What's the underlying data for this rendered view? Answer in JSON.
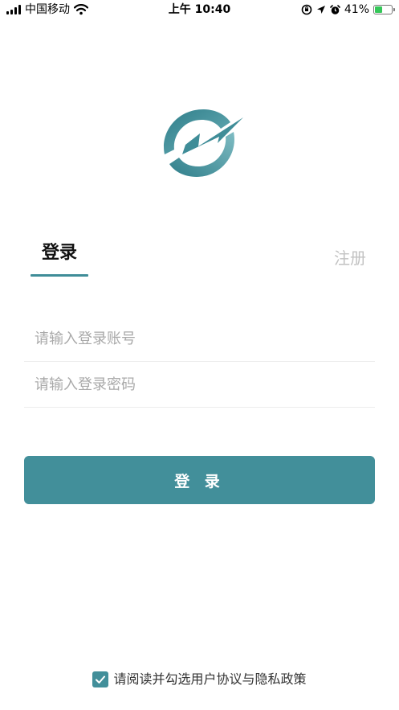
{
  "status_bar": {
    "carrier": "中国移动",
    "time": "上午 10:40",
    "battery_percent": "41%",
    "battery_level": 0.41,
    "icons": [
      "signal-icon",
      "wifi-icon",
      "orientation-lock-icon",
      "location-icon",
      "alarm-icon",
      "battery-icon"
    ]
  },
  "logo": {
    "icon": "app-logo-icon",
    "color": "#3f8d98"
  },
  "tabs": [
    {
      "label": "登录",
      "active": true
    },
    {
      "label": "注册",
      "active": false
    }
  ],
  "form": {
    "account_placeholder": "请输入登录账号",
    "password_placeholder": "请输入登录密码",
    "login_button": "登 录"
  },
  "agreement": {
    "text": "请阅读并勾选用户协议与隐私政策",
    "checked": true
  },
  "colors": {
    "accent": "#428f9a",
    "inactive_tab": "#c2c2c2",
    "placeholder": "#a9a9a9"
  }
}
